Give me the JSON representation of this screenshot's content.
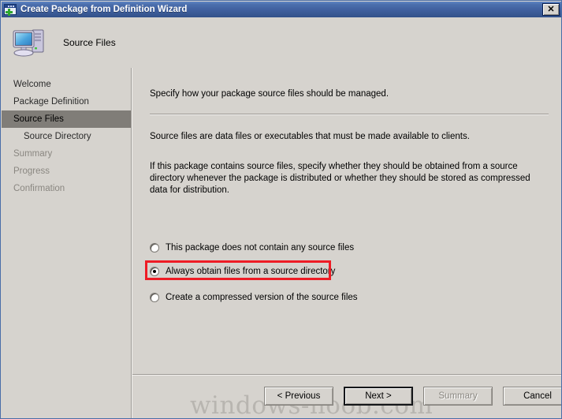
{
  "window": {
    "title": "Create Package from Definition Wizard",
    "icon": "package-wizard-icon",
    "close_label": "✕"
  },
  "header": {
    "icon": "computer-icon",
    "title": "Source Files"
  },
  "sidebar": {
    "items": [
      {
        "label": "Welcome",
        "state": "normal",
        "indent": false
      },
      {
        "label": "Package Definition",
        "state": "normal",
        "indent": false
      },
      {
        "label": "Source Files",
        "state": "selected",
        "indent": false
      },
      {
        "label": "Source Directory",
        "state": "normal",
        "indent": true
      },
      {
        "label": "Summary",
        "state": "disabled",
        "indent": false
      },
      {
        "label": "Progress",
        "state": "disabled",
        "indent": false
      },
      {
        "label": "Confirmation",
        "state": "disabled",
        "indent": false
      }
    ]
  },
  "content": {
    "intro": "Specify how your package source files should be managed.",
    "description": "Source files are data files or executables that must be made available to clients.",
    "paragraph": "If this package contains source files, specify whether they should be obtained from a source directory whenever the package is distributed or whether they should be stored as compressed data for distribution.",
    "options": [
      {
        "label": "This package does not contain any source files",
        "checked": false
      },
      {
        "label": "Always obtain files from a source directory",
        "checked": true
      },
      {
        "label": "Create a compressed version of the source files",
        "checked": false
      }
    ],
    "highlight_color": "#ee1c25"
  },
  "footer": {
    "buttons": [
      {
        "label": "< Previous",
        "state": "normal"
      },
      {
        "label": "Next >",
        "state": "default"
      },
      {
        "label": "Summary",
        "state": "disabled"
      },
      {
        "label": "Cancel",
        "state": "normal"
      }
    ]
  },
  "watermark": {
    "text": "windows-noob.com"
  },
  "colors": {
    "titlebar": "#3f5f9e",
    "surface": "#d6d3ce",
    "selected_nav": "#807d78",
    "accent_red": "#ee1c25"
  }
}
